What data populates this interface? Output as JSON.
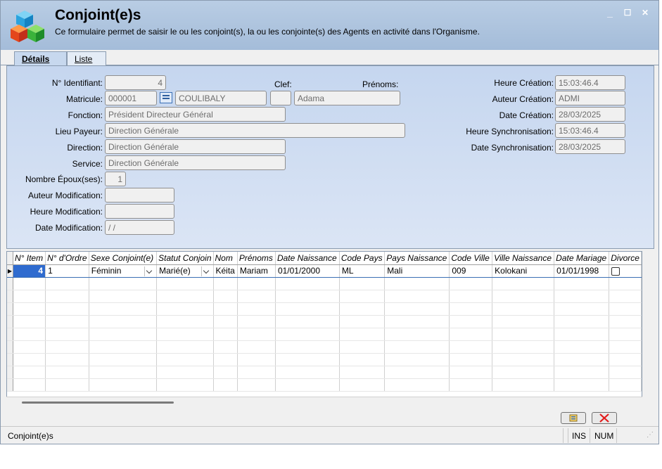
{
  "header": {
    "title": "Conjoint(e)s",
    "subtitle": "Ce formulaire permet de saisir le ou les conjoint(s), la ou les conjointe(s) des Agents en activité dans l'Organisme.",
    "controls": {
      "minimize": "_",
      "maximize": "☐",
      "close": "✕"
    }
  },
  "tabs": [
    {
      "label": "Détails",
      "active": true
    },
    {
      "label": "Liste",
      "active": false
    }
  ],
  "form": {
    "identifiant": {
      "label": "N° Identifiant:",
      "value": "4"
    },
    "clef": {
      "label": "Clef:",
      "value": ""
    },
    "prenoms": {
      "label": "Prénoms:",
      "value": "Adama"
    },
    "matricule": {
      "label": "Matricule:",
      "value": "000001",
      "nom": "COULIBALY"
    },
    "fonction": {
      "label": "Fonction:",
      "value": "Président Directeur Général"
    },
    "lieu_payeur": {
      "label": "Lieu Payeur:",
      "value": "Direction Générale"
    },
    "direction": {
      "label": "Direction:",
      "value": "Direction Générale"
    },
    "service": {
      "label": "Service:",
      "value": "Direction Générale"
    },
    "nombre_epoux": {
      "label": "Nombre Époux(ses):",
      "value": "1"
    },
    "auteur_modification": {
      "label": "Auteur Modification:",
      "value": ""
    },
    "heure_modification": {
      "label": "Heure Modification:",
      "value": ""
    },
    "date_modification": {
      "label": "Date Modification:",
      "value": " / /"
    },
    "heure_creation": {
      "label": "Heure Création:",
      "value": "15:03:46.4"
    },
    "auteur_creation": {
      "label": "Auteur Création:",
      "value": "ADMI"
    },
    "date_creation": {
      "label": "Date Création:",
      "value": "28/03/2025"
    },
    "heure_sync": {
      "label": "Heure Synchronisation:",
      "value": "15:03:46.4"
    },
    "date_sync": {
      "label": "Date Synchronisation:",
      "value": "28/03/2025"
    }
  },
  "grid": {
    "columns": [
      "N° Item",
      "N° d'Ordre",
      "Sexe Conjoint(e)",
      "Statut Conjoin",
      "Nom",
      "Prénoms",
      "Date Naissance",
      "Code Pays",
      "Pays Naissance",
      "Code Ville",
      "Ville Naissance",
      "Date Mariage",
      "Divorce"
    ],
    "rows": [
      [
        "4",
        "1",
        "Féminin",
        "Marié(e)",
        "Kéita",
        "Mariam",
        "01/01/2000",
        "ML",
        "Mali",
        "009",
        "Kolokani",
        "01/01/1998",
        ""
      ]
    ]
  },
  "status_bar": {
    "text": "Conjoint(e)s",
    "ins": "INS",
    "num": "NUM"
  },
  "colors": {
    "header_bg": "#b9cde4",
    "form_bg": "#c5d6ef",
    "selection": "#2f6bcf"
  }
}
